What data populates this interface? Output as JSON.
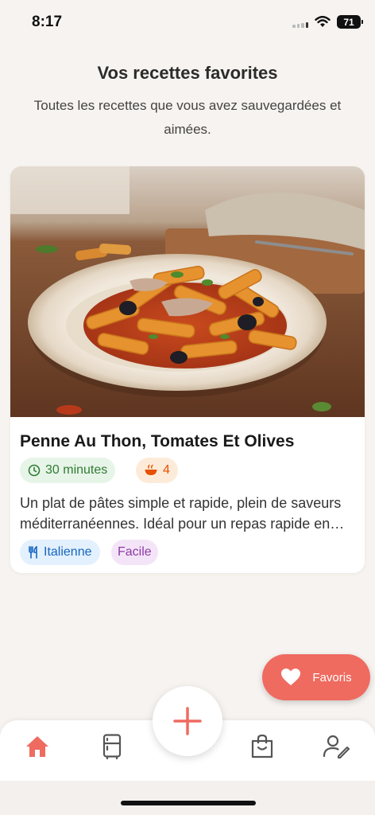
{
  "status_bar": {
    "time": "8:17",
    "battery": "71"
  },
  "header": {
    "title": "Vos recettes favorites",
    "subtitle": "Toutes les recettes que vous avez sauvegardées et aimées."
  },
  "recipe": {
    "title": "Penne Au Thon, Tomates Et Olives",
    "time": "30 minutes",
    "servings": "4",
    "description": "Un plat de pâtes simple et rapide, plein de saveurs méditerranéennes. Idéal pour un repas rapide en semaine.",
    "cuisine": "Italienne",
    "difficulty": "Facile",
    "image_icon": "pasta-dish-photo"
  },
  "favorites_button": {
    "label": "Favoris",
    "icon": "heart-icon"
  },
  "bottom_nav": {
    "items": [
      {
        "icon": "home-icon",
        "active": true
      },
      {
        "icon": "fridge-icon",
        "active": false
      },
      {
        "icon": "plus-icon",
        "active": false
      },
      {
        "icon": "shopping-bag-icon",
        "active": false
      },
      {
        "icon": "user-edit-icon",
        "active": false
      }
    ]
  },
  "colors": {
    "accent": "#ef6b60",
    "background": "#f7f3f0",
    "time_chip": "#2e7d32",
    "servings_chip": "#e65100",
    "cuisine_chip": "#1565c0",
    "difficulty_chip": "#8e3aa6"
  }
}
